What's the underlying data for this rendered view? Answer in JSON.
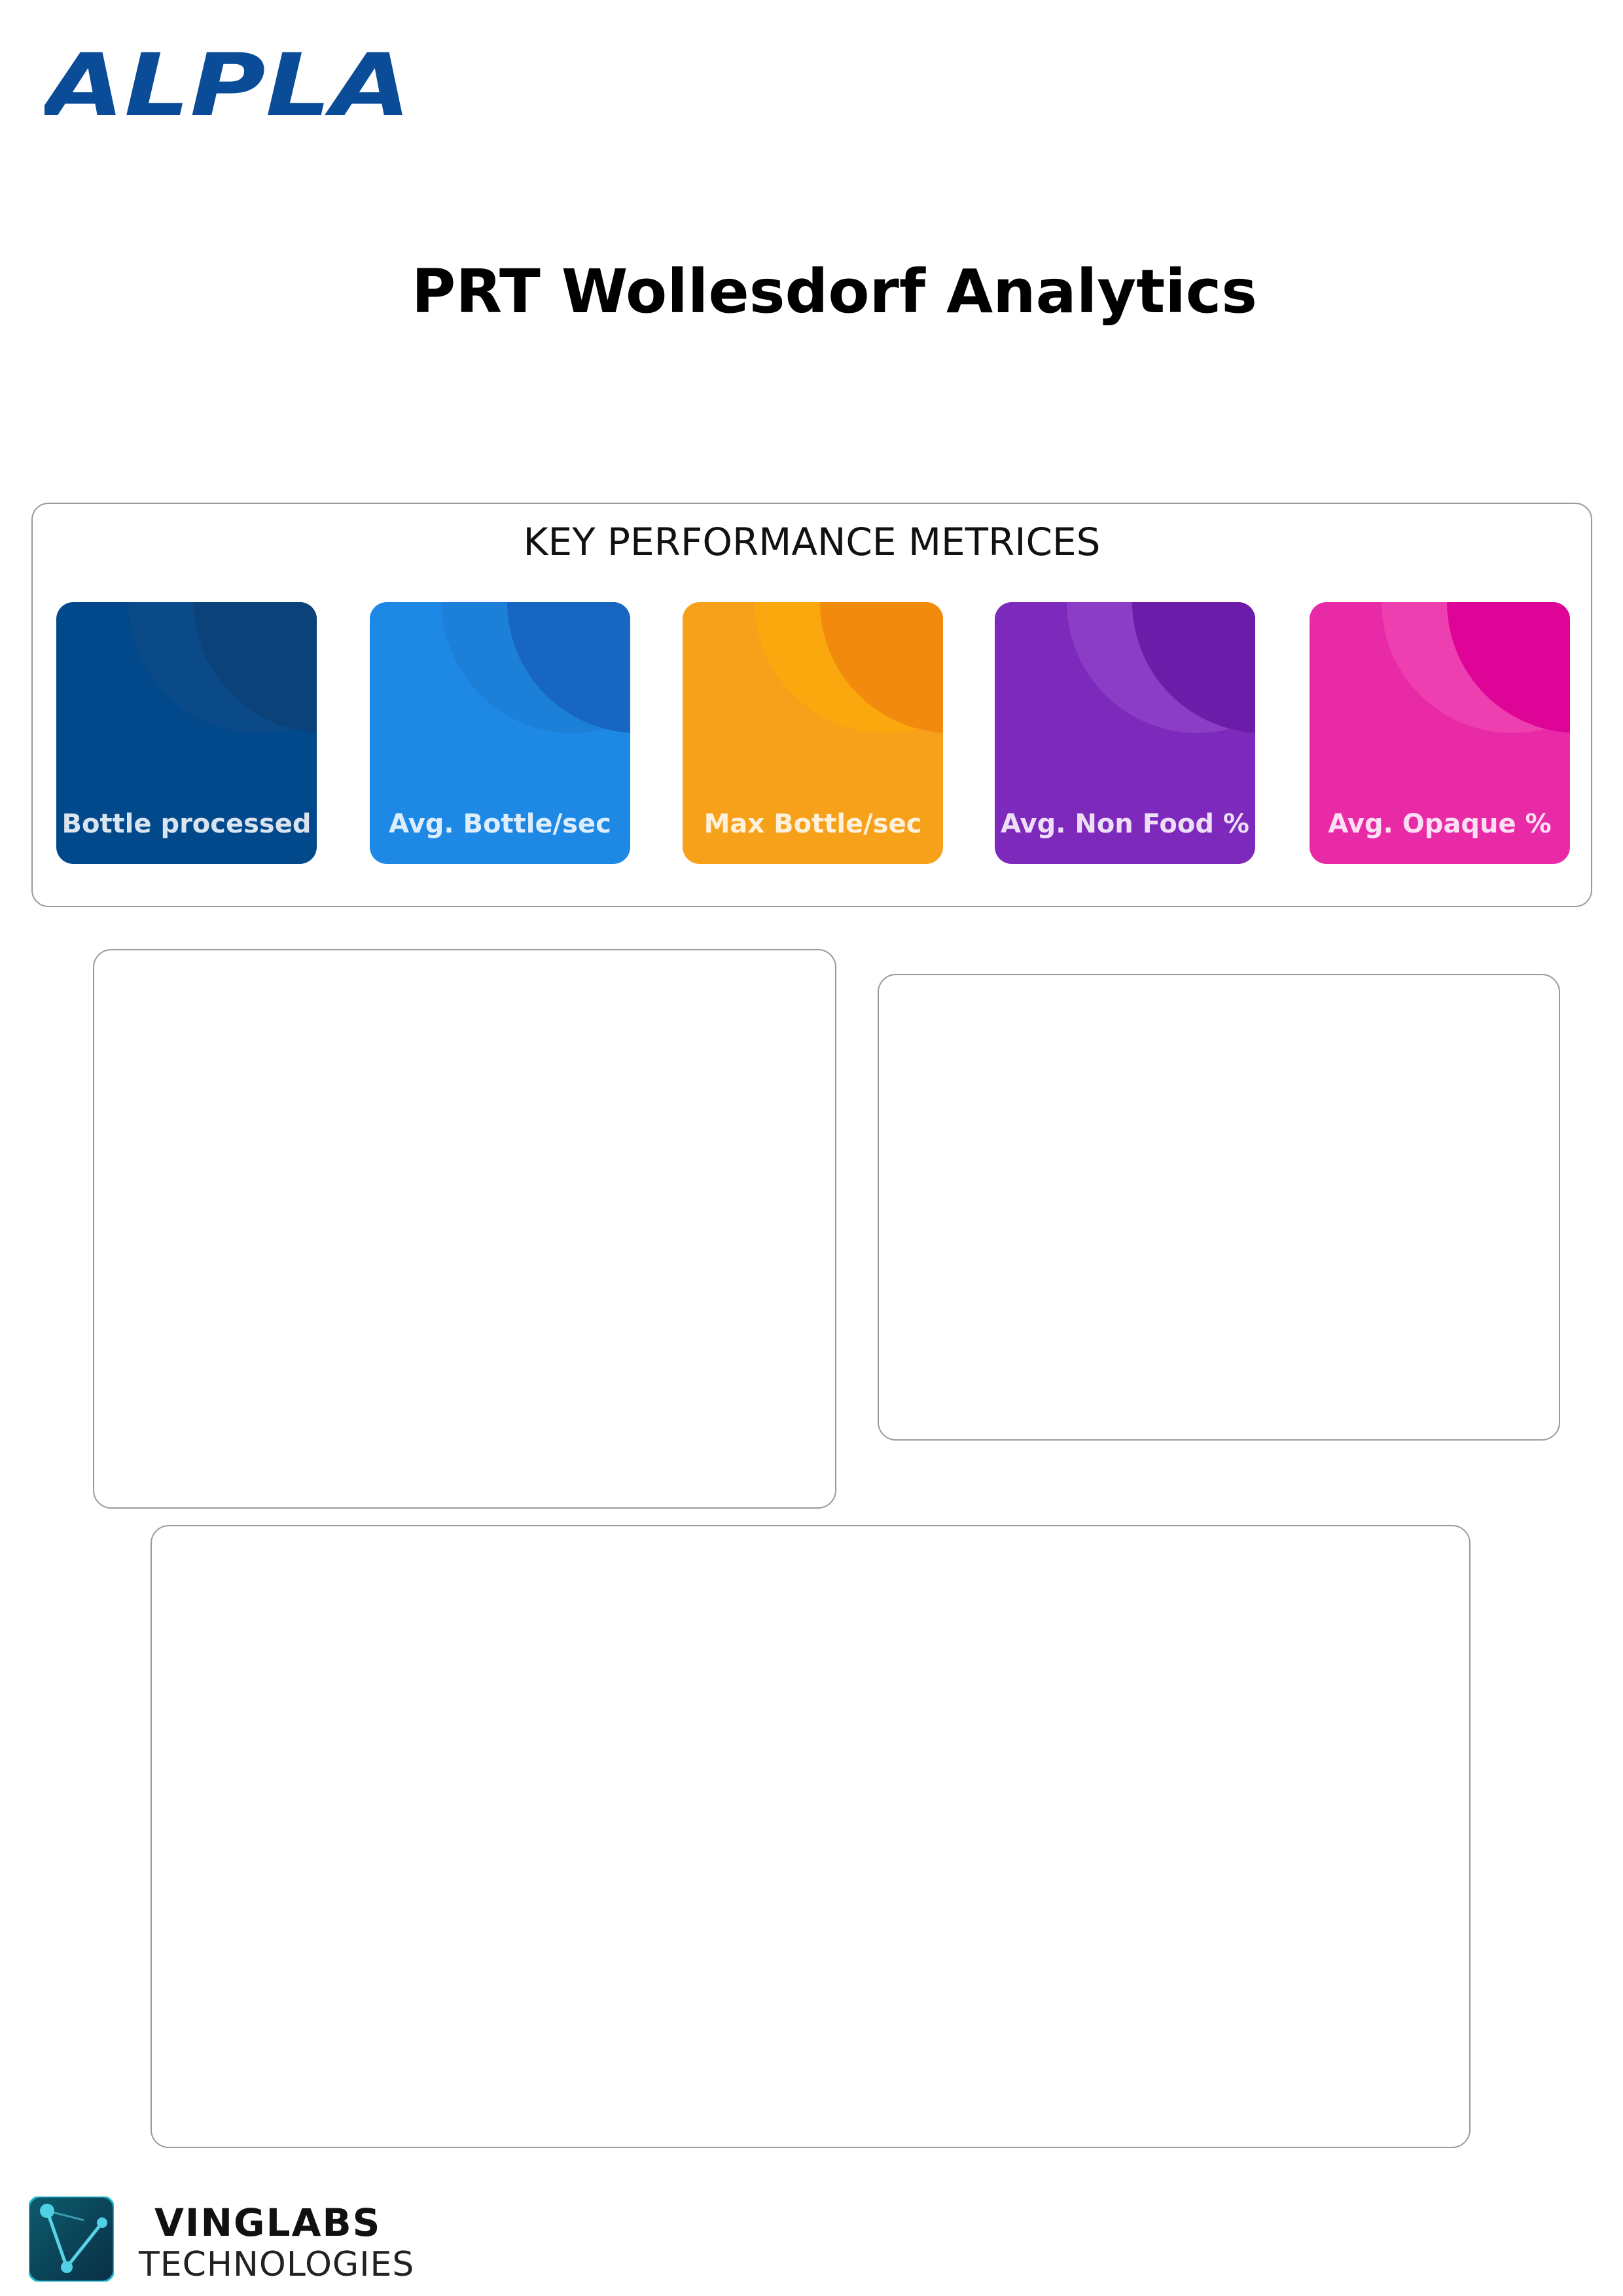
{
  "header": {
    "brand": "ALPLA",
    "brand_color": "#0a4c98",
    "title": "PRT Wollesdorf Analytics"
  },
  "kpi": {
    "heading": "KEY PERFORMANCE METRICES",
    "cards": [
      {
        "label": "Bottle processed",
        "color": "#02498c",
        "arc1": "#0a4a88",
        "arc2": "#0b4279"
      },
      {
        "label": "Avg. Bottle/sec",
        "color": "#1e88e5",
        "arc1": "#1c7fd8",
        "arc2": "#1766c2"
      },
      {
        "label": "Max Bottle/sec",
        "color": "#f7a11a",
        "arc1": "#fba80f",
        "arc2": "#f28a0e"
      },
      {
        "label": "Avg. Non Food %",
        "color": "#7d29bc",
        "arc1": "#8b3ec5",
        "arc2": "#6b1ca8"
      },
      {
        "label": "Avg. Opaque %",
        "color": "#e92aa7",
        "arc1": "#ee3fb0",
        "arc2": "#de0497"
      }
    ]
  },
  "footer": {
    "company": "VINGLABS",
    "tagline": "TECHNOLOGIES"
  }
}
